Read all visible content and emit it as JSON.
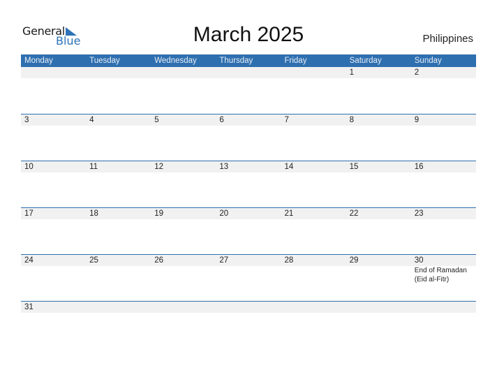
{
  "logo": {
    "word1": "General",
    "word2": "Blue"
  },
  "title": "March 2025",
  "country": "Philippines",
  "colors": {
    "accent": "#2e6faf",
    "band": "#f1f1f1"
  },
  "weekdays": [
    "Monday",
    "Tuesday",
    "Wednesday",
    "Thursday",
    "Friday",
    "Saturday",
    "Sunday"
  ],
  "weeks": [
    {
      "days": [
        "",
        "",
        "",
        "",
        "",
        "1",
        "2"
      ],
      "events": [
        "",
        "",
        "",
        "",
        "",
        "",
        ""
      ]
    },
    {
      "days": [
        "3",
        "4",
        "5",
        "6",
        "7",
        "8",
        "9"
      ],
      "events": [
        "",
        "",
        "",
        "",
        "",
        "",
        ""
      ]
    },
    {
      "days": [
        "10",
        "11",
        "12",
        "13",
        "14",
        "15",
        "16"
      ],
      "events": [
        "",
        "",
        "",
        "",
        "",
        "",
        ""
      ]
    },
    {
      "days": [
        "17",
        "18",
        "19",
        "20",
        "21",
        "22",
        "23"
      ],
      "events": [
        "",
        "",
        "",
        "",
        "",
        "",
        ""
      ]
    },
    {
      "days": [
        "24",
        "25",
        "26",
        "27",
        "28",
        "29",
        "30"
      ],
      "events": [
        "",
        "",
        "",
        "",
        "",
        "",
        "End of Ramadan\n(Eid al-Fitr)"
      ]
    },
    {
      "days": [
        "31",
        "",
        "",
        "",
        "",
        "",
        ""
      ],
      "events": [
        "",
        "",
        "",
        "",
        "",
        "",
        ""
      ]
    }
  ]
}
